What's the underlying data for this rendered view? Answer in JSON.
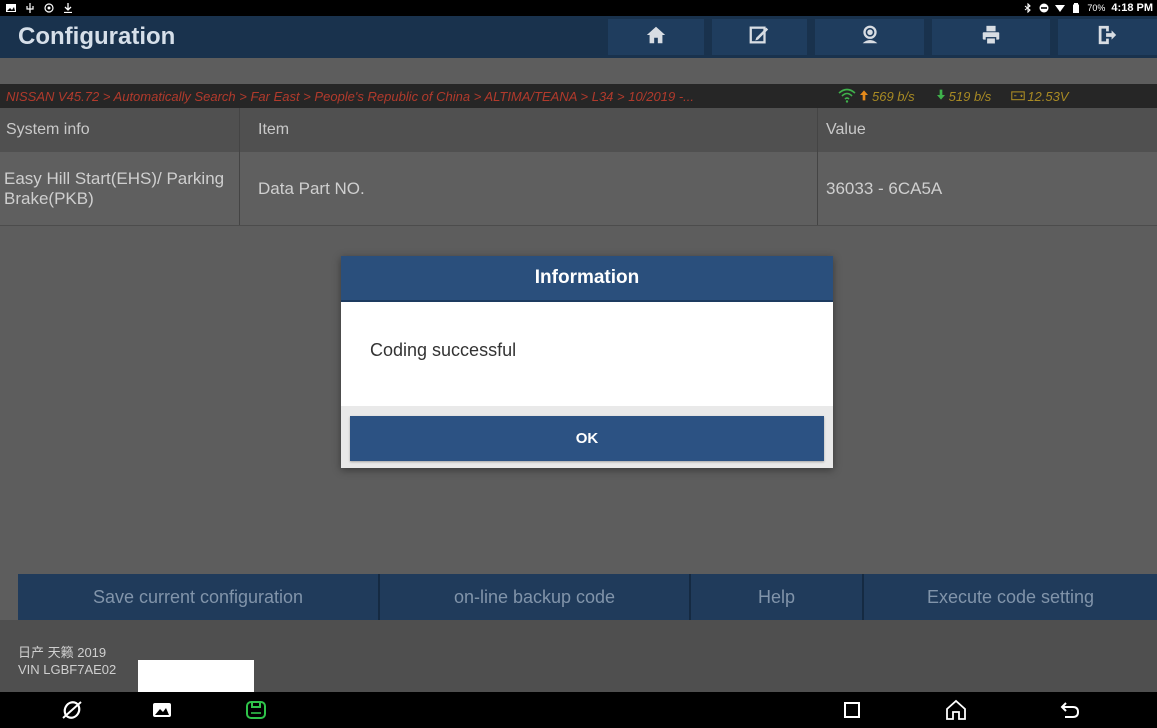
{
  "statusbar": {
    "battery_pct": "70%",
    "time": "4:18 PM"
  },
  "header": {
    "title": "Configuration",
    "icons": [
      "home-icon",
      "edit-icon",
      "support-icon",
      "print-icon",
      "exit-icon"
    ]
  },
  "breadcrumb": {
    "path": "NISSAN V45.72 > Automatically Search > Far East > People's Republic of China > ALTIMA/TEANA > L34 > 10/2019 -...",
    "upload_speed": "569 b/s",
    "download_speed": "519 b/s",
    "voltage": "12.53V"
  },
  "table": {
    "headers": [
      "System info",
      "Item",
      "Value"
    ],
    "rows": [
      {
        "system": "Easy Hill Start(EHS)/ Parking Brake(PKB)",
        "item": "Data Part NO.",
        "value": "36033 - 6CA5A"
      }
    ]
  },
  "dialog": {
    "title": "Information",
    "message": "Coding successful",
    "ok_label": "OK"
  },
  "actions": {
    "save": "Save current configuration",
    "backup": "on-line backup code",
    "help": "Help",
    "execute": "Execute code setting"
  },
  "footer": {
    "vehicle": "日产 天籁 2019",
    "vin": "VIN LGBF7AE02"
  },
  "colors": {
    "title_bar": "#19324d",
    "breadcrumb_text": "#b13a2c",
    "dialog_header": "#2a4f7c",
    "ok_button": "#2c5283"
  }
}
